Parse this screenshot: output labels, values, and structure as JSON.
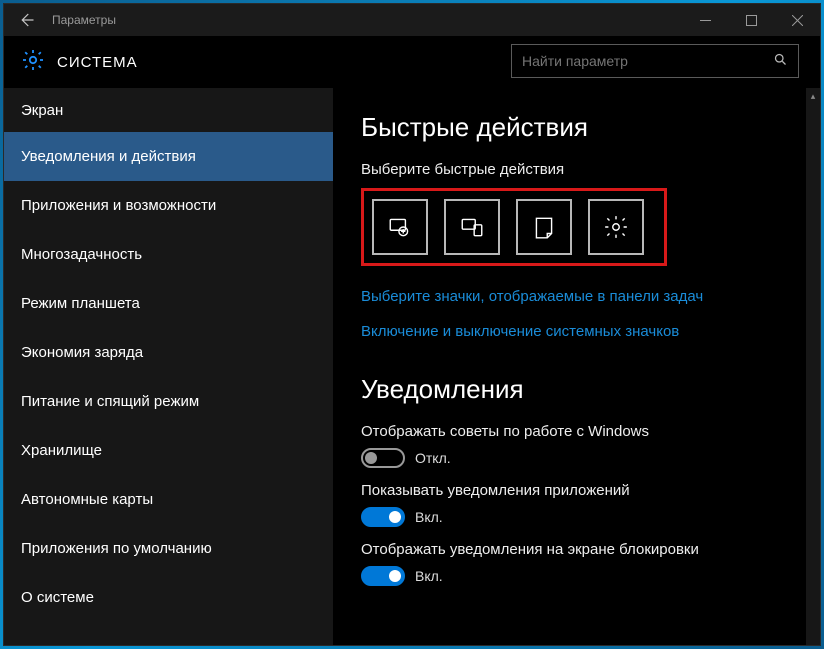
{
  "titlebar": {
    "title": "Параметры"
  },
  "header": {
    "section_title": "СИСТЕМА",
    "search_placeholder": "Найти параметр"
  },
  "sidebar": {
    "items": [
      "Экран",
      "Уведомления и действия",
      "Приложения и возможности",
      "Многозадачность",
      "Режим планшета",
      "Экономия заряда",
      "Питание и спящий режим",
      "Хранилище",
      "Автономные карты",
      "Приложения по умолчанию",
      "О системе"
    ],
    "active_index": 1
  },
  "content": {
    "quick_actions": {
      "heading": "Быстрые действия",
      "pick_label": "Выберите быстрые действия",
      "tiles": [
        "tablet-mode-icon",
        "connect-icon",
        "note-icon",
        "all-settings-icon"
      ]
    },
    "links": {
      "taskbar_icons": "Выберите значки, отображаемые в панели задач",
      "system_icons": "Включение и выключение системных значков"
    },
    "notifications": {
      "heading": "Уведомления",
      "settings": [
        {
          "label": "Отображать советы по работе с Windows",
          "on": false
        },
        {
          "label": "Показывать уведомления приложений",
          "on": true
        },
        {
          "label": "Отображать уведомления на экране блокировки",
          "on": true
        }
      ]
    },
    "toggle_states": {
      "on": "Вкл.",
      "off": "Откл."
    }
  }
}
